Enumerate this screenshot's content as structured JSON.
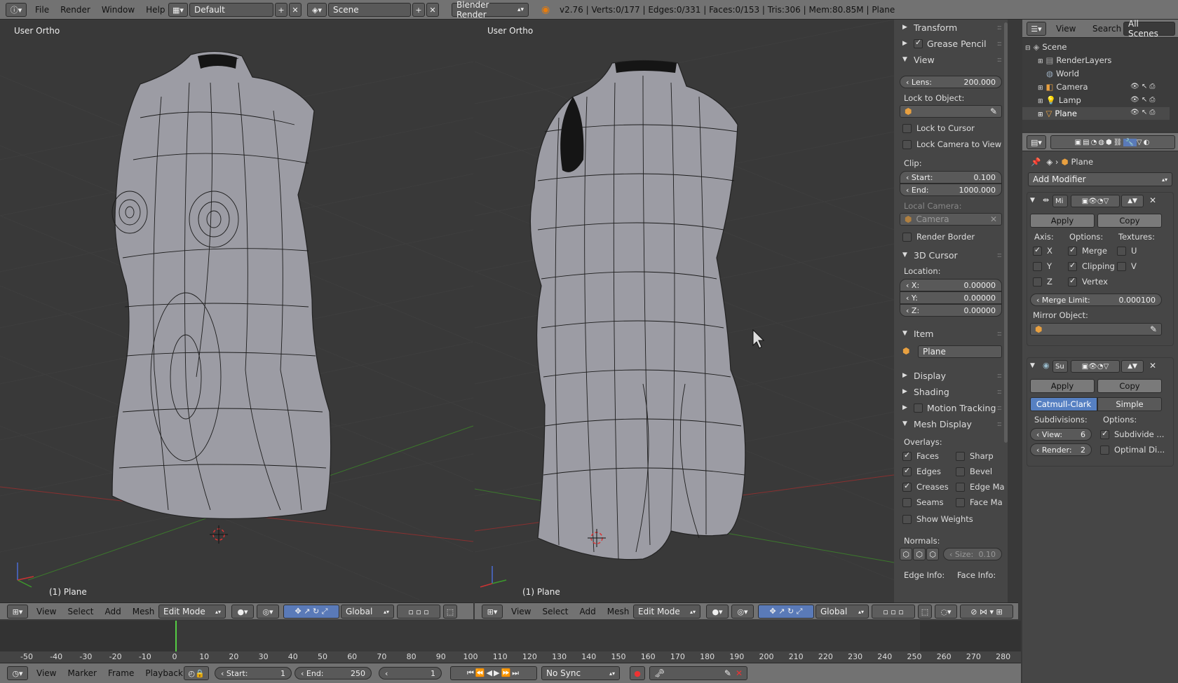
{
  "topbar": {
    "menus": [
      "File",
      "Render",
      "Window",
      "Help"
    ],
    "layout": "Default",
    "scene": "Scene",
    "engine": "Blender Render",
    "stats": "v2.76 | Verts:0/177 | Edges:0/331 | Faces:0/153 | Tris:306 | Mem:80.85M | Plane"
  },
  "viewports": [
    {
      "label": "User Ortho",
      "footer": "(1) Plane"
    },
    {
      "label": "User Ortho",
      "footer": "(1) Plane"
    }
  ],
  "view3d_header": {
    "menus": [
      "View",
      "Select",
      "Add",
      "Mesh"
    ],
    "mode": "Edit Mode",
    "orientation": "Global"
  },
  "properties_n": {
    "transform": "Transform",
    "grease_pencil": "Grease Pencil",
    "view": "View",
    "lens_label": "Lens:",
    "lens_value": "200.000",
    "lock_to_object": "Lock to Object:",
    "lock_to_cursor": "Lock to Cursor",
    "lock_camera": "Lock Camera to View",
    "clip": "Clip:",
    "clip_start_label": "Start:",
    "clip_start": "0.100",
    "clip_end_label": "End:",
    "clip_end": "1000.000",
    "local_camera": "Local Camera:",
    "camera_field": "Camera",
    "render_border": "Render Border",
    "cursor3d": "3D Cursor",
    "location": "Location:",
    "x_label": "X:",
    "x": "0.00000",
    "y_label": "Y:",
    "y": "0.00000",
    "z_label": "Z:",
    "z": "0.00000",
    "item": "Item",
    "item_name": "Plane",
    "display": "Display",
    "shading": "Shading",
    "motion_tracking": "Motion Tracking",
    "mesh_display": "Mesh Display",
    "overlays": "Overlays:",
    "faces": "Faces",
    "sharp": "Sharp",
    "edges": "Edges",
    "bevel": "Bevel",
    "creases": "Creases",
    "edge_ma": "Edge Ma",
    "seams": "Seams",
    "face_ma": "Face Ma",
    "show_weights": "Show Weights",
    "normals": "Normals:",
    "size_label": "Size:",
    "size": "0.10",
    "edge_info": "Edge Info:",
    "face_info": "Face Info:"
  },
  "outliner": {
    "tabs": [
      "View",
      "Search",
      "All Scenes"
    ],
    "items": [
      "Scene",
      "RenderLayers",
      "World",
      "Camera",
      "Lamp",
      "Plane"
    ]
  },
  "modifiers": {
    "breadcrumb": "Plane",
    "add_modifier": "Add Modifier",
    "mirror": {
      "name": "Mi",
      "apply": "Apply",
      "copy": "Copy",
      "axis": "Axis:",
      "options": "Options:",
      "textures": "Textures:",
      "x": "X",
      "y": "Y",
      "z": "Z",
      "merge": "Merge",
      "clipping": "Clipping",
      "vertex": "Vertex",
      "u": "U",
      "v": "V",
      "merge_limit_label": "Merge Limit:",
      "merge_limit": "0.000100",
      "mirror_object": "Mirror Object:"
    },
    "subsurf": {
      "name": "Su",
      "apply": "Apply",
      "copy": "Copy",
      "catmull": "Catmull-Clark",
      "simple": "Simple",
      "subdivisions": "Subdivisions:",
      "options": "Options:",
      "view_label": "View:",
      "view": "6",
      "render_label": "Render:",
      "render": "2",
      "subdivide": "Subdivide ...",
      "optimal": "Optimal Di..."
    }
  },
  "timeline": {
    "ticks": [
      "-50",
      "-40",
      "-30",
      "-20",
      "-10",
      "0",
      "10",
      "20",
      "30",
      "40",
      "50",
      "60",
      "70",
      "80",
      "90",
      "100",
      "110",
      "120",
      "130",
      "140",
      "150",
      "160",
      "170",
      "180",
      "190",
      "200",
      "210",
      "220",
      "230",
      "240",
      "250",
      "260",
      "270",
      "280"
    ],
    "menus": [
      "View",
      "Marker",
      "Frame",
      "Playback"
    ],
    "start_label": "Start:",
    "start": "1",
    "end_label": "End:",
    "end": "250",
    "current": "1",
    "sync": "No Sync"
  }
}
